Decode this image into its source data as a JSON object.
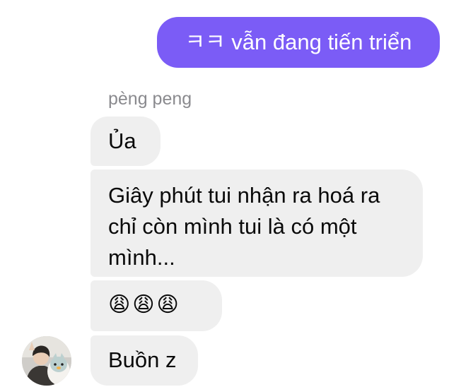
{
  "thread": {
    "outgoing_message": "ㅋㅋ vẫn đang tiến triển",
    "sender_name": "pèng peng",
    "incoming_messages": [
      "Ủa",
      "Giây phút tui nhận ra hoá ra chỉ còn mình tui là có một mình...",
      "😩😩😩",
      "Buồn z"
    ]
  },
  "colors": {
    "outgoing_bubble": "#7b5cf6",
    "incoming_bubble": "#efefef",
    "sender_name": "#8a8a8e"
  },
  "icons": {
    "avatar": "avatar-photo"
  }
}
